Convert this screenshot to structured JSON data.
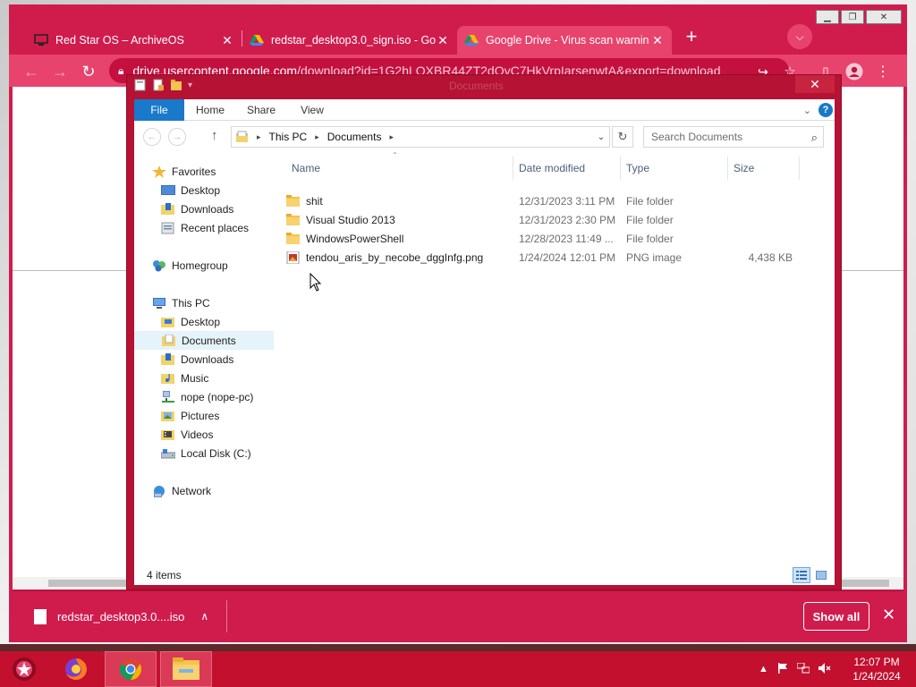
{
  "browser": {
    "tabs": [
      {
        "title": "Red Star OS – ArchiveOS",
        "icon": "monitor-icon",
        "active": false
      },
      {
        "title": "redstar_desktop3.0_sign.iso - Goo",
        "icon": "google-drive-icon",
        "active": false
      },
      {
        "title": "Google Drive - Virus scan warnin",
        "icon": "google-drive-icon",
        "active": true
      }
    ],
    "url_host": "drive.usercontent.google.com",
    "url_path": "/download?id=1G2hLOXBR44ZT2dOvC7HkVrpIarsenwtA&export=download",
    "download": {
      "filename": "redstar_desktop3.0....iso",
      "show_all_label": "Show all"
    },
    "accent": "#e8436c",
    "frame": "#d01c4d"
  },
  "explorer": {
    "title": "Documents",
    "ribbon_tabs": [
      "File",
      "Home",
      "Share",
      "View"
    ],
    "breadcrumb": [
      "This PC",
      "Documents"
    ],
    "search_placeholder": "Search Documents",
    "columns": [
      "Name",
      "Date modified",
      "Type",
      "Size"
    ],
    "files": [
      {
        "name": "shit",
        "date": "12/31/2023 3:11 PM",
        "type": "File folder",
        "size": "",
        "icon": "folder-icon"
      },
      {
        "name": "Visual Studio 2013",
        "date": "12/31/2023 2:30 PM",
        "type": "File folder",
        "size": "",
        "icon": "folder-icon"
      },
      {
        "name": "WindowsPowerShell",
        "date": "12/28/2023 11:49 ...",
        "type": "File folder",
        "size": "",
        "icon": "folder-icon"
      },
      {
        "name": "tendou_aris_by_necobe_dggInfg.png",
        "date": "1/24/2024 12:01 PM",
        "type": "PNG image",
        "size": "4,438 KB",
        "icon": "png-image-icon"
      }
    ],
    "nav": {
      "favorites": "Favorites",
      "favorites_items": [
        "Desktop",
        "Downloads",
        "Recent places"
      ],
      "homegroup": "Homegroup",
      "this_pc": "This PC",
      "this_pc_items": [
        "Desktop",
        "Documents",
        "Downloads",
        "Music",
        "nope (nope-pc)",
        "Pictures",
        "Videos",
        "Local Disk (C:)"
      ],
      "network": "Network"
    },
    "status": "4 items"
  },
  "taskbar": {
    "time": "12:07 PM",
    "date": "1/24/2024",
    "color": "#c2102e"
  }
}
